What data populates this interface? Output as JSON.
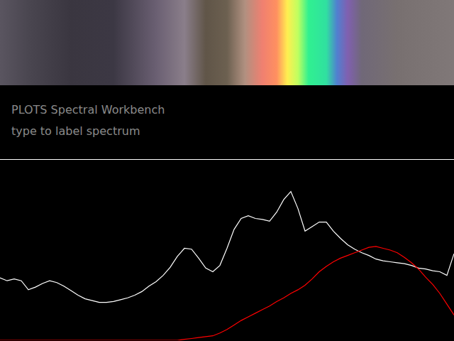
{
  "app": {
    "title": "PLOTS Spectral Workbench",
    "hint": "type to label spectrum"
  },
  "chart": {
    "y_max": 100,
    "series": [
      {
        "color": "#ffffff",
        "values": [
          34.6,
          33,
          34,
          33,
          28,
          29.5,
          31.5,
          33,
          32,
          30,
          27.5,
          25,
          23,
          22,
          21,
          21,
          21.5,
          22.5,
          23.5,
          25,
          27,
          30,
          32.5,
          36,
          40.5,
          46.5,
          51,
          50.5,
          45.5,
          40,
          38,
          41.5,
          51,
          61.5,
          67.5,
          69,
          67.5,
          67,
          66,
          71,
          78,
          82.5,
          73,
          60.5,
          63,
          65.5,
          65.5,
          60.5,
          56.5,
          53,
          50.5,
          48.5,
          47,
          45,
          44,
          43.5,
          43,
          42.5,
          41.5,
          40,
          39.5,
          38.5,
          38,
          36,
          48
        ]
      },
      {
        "color": "#ff0000",
        "values": [
          0,
          0,
          0,
          0,
          0,
          0,
          0,
          0,
          0,
          0,
          0,
          0,
          0,
          0,
          0,
          0,
          0,
          0,
          0,
          0,
          0,
          0,
          0,
          0,
          0,
          0,
          0.5,
          1,
          1.5,
          2,
          2.5,
          4,
          6,
          8.5,
          11,
          13,
          15,
          17,
          19,
          21.5,
          23.5,
          26,
          28,
          30.5,
          34,
          38,
          41,
          43.5,
          45.5,
          47,
          48.5,
          50,
          51.5,
          52,
          51,
          50,
          48.5,
          46,
          43,
          39.5,
          35,
          31,
          26,
          20,
          14
        ]
      }
    ]
  }
}
